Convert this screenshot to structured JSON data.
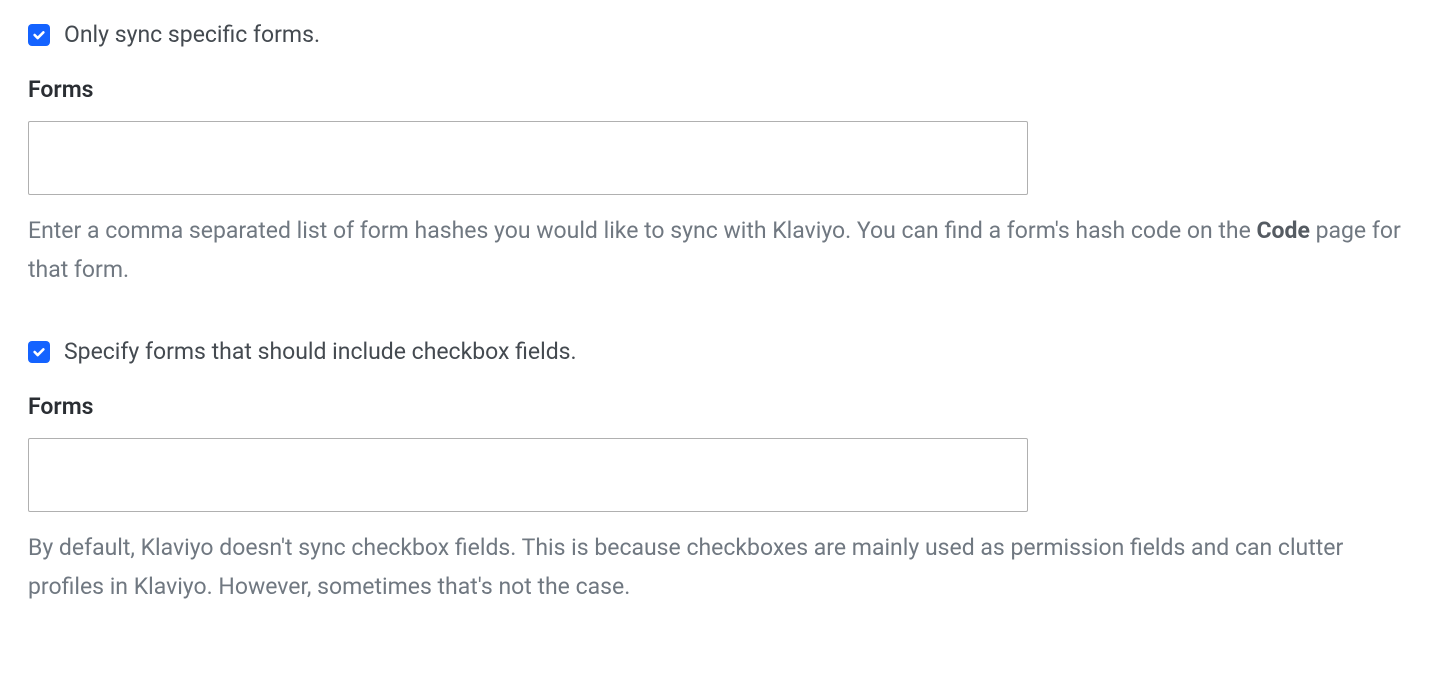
{
  "section1": {
    "checkbox_label": "Only sync specific forms.",
    "field_label": "Forms",
    "input_value": "",
    "helper_pre": "Enter a comma separated list of form hashes you would like to sync with Klaviyo. You can find a form's hash code on the ",
    "helper_bold": "Code",
    "helper_post": " page for that form."
  },
  "section2": {
    "checkbox_label": "Specify forms that should include checkbox fields.",
    "field_label": "Forms",
    "input_value": "",
    "helper": "By default, Klaviyo doesn't sync checkbox fields. This is because checkboxes are mainly used as permission fields and can clutter profiles in Klaviyo. However, sometimes that's not the case."
  }
}
